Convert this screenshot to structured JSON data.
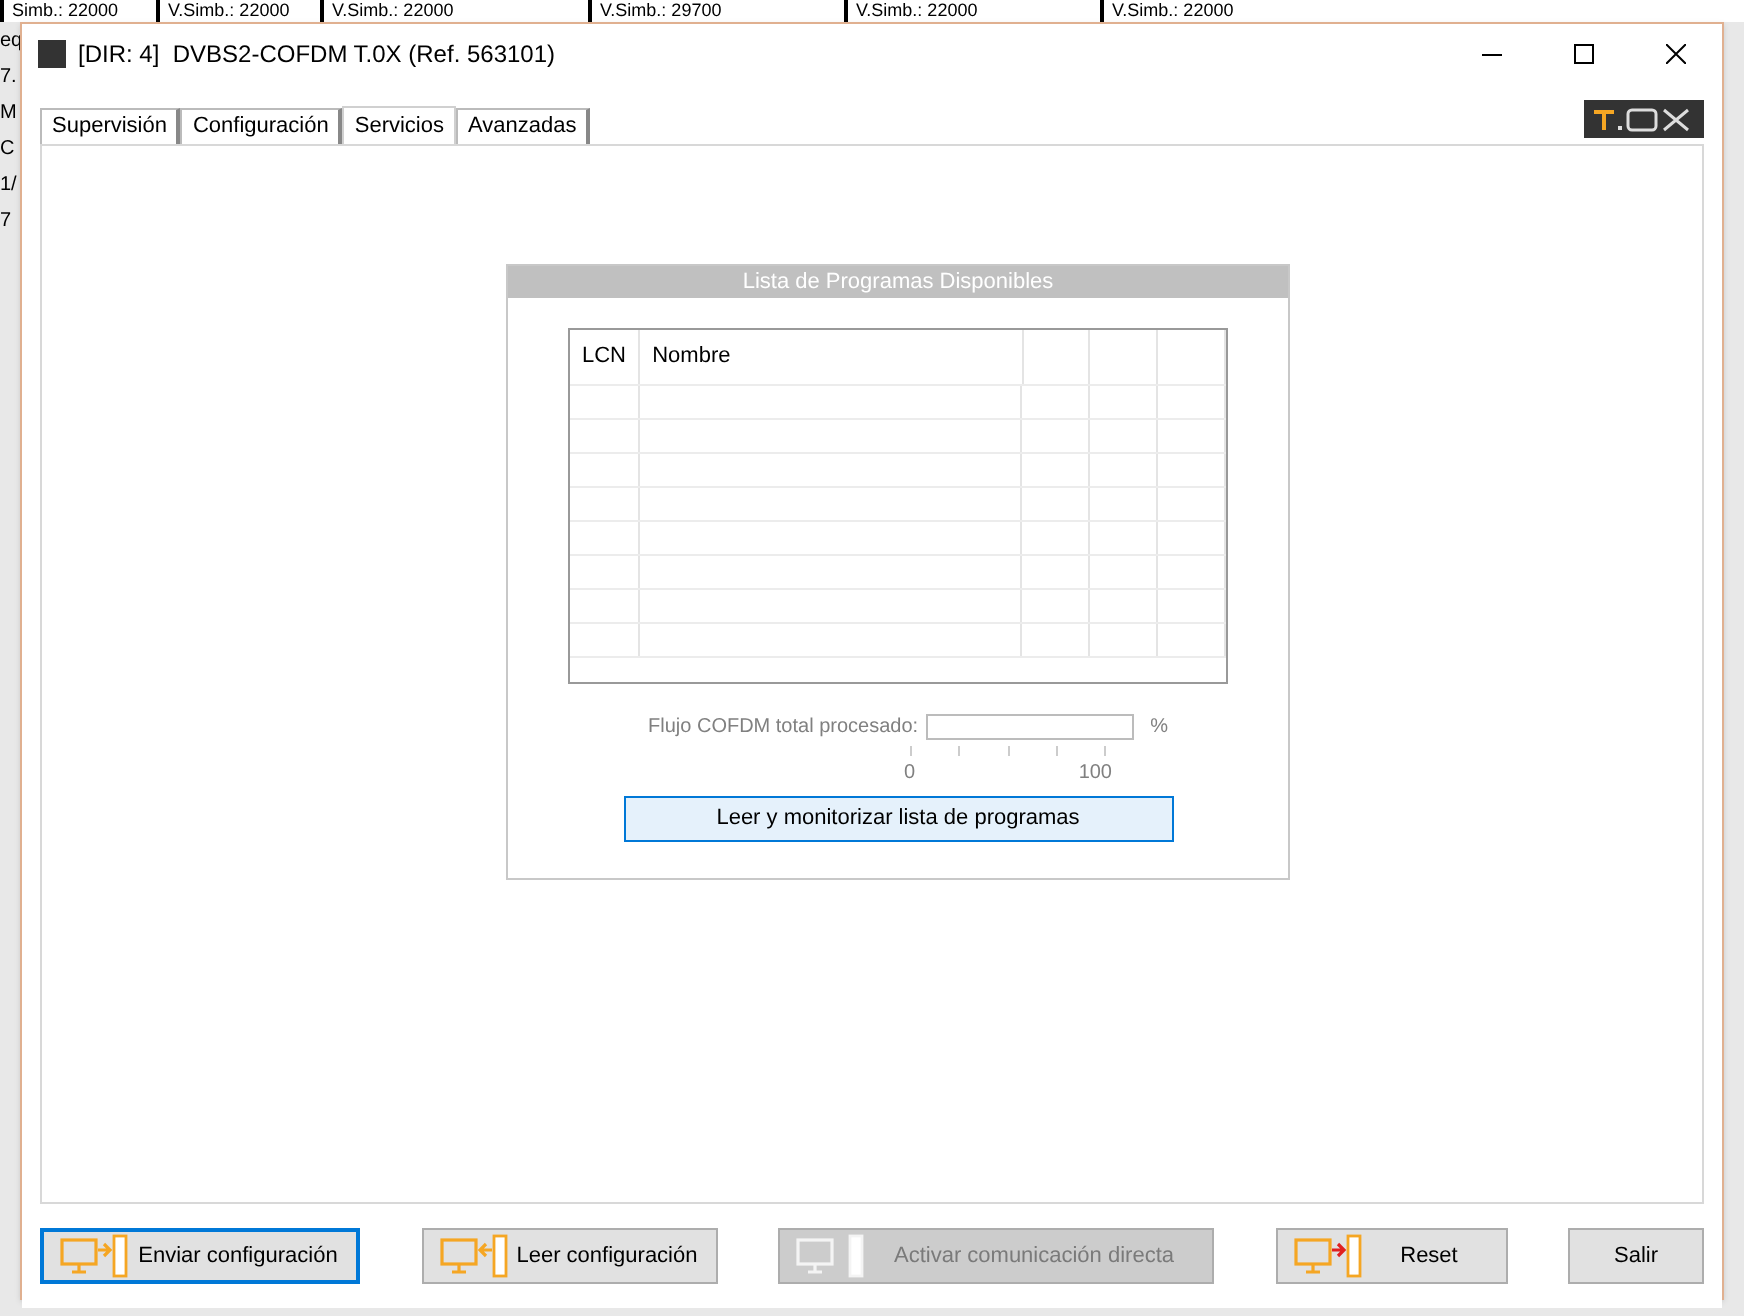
{
  "background_window": {
    "header_cells": [
      "Simb.: 22000",
      "V.Simb.: 22000",
      "V.Simb.: 22000",
      "V.Simb.: 29700",
      "V.Simb.: 22000",
      "V.Simb.: 22000"
    ],
    "side_fragments": [
      "eq",
      "7.",
      "M",
      "C",
      "1/",
      "7"
    ]
  },
  "window": {
    "title": "[DIR: 4]  DVBS2-COFDM T.0X (Ref. 563101)"
  },
  "tabs": [
    {
      "label": "Supervisión",
      "selected": false
    },
    {
      "label": "Configuración",
      "selected": false
    },
    {
      "label": "Servicios",
      "selected": true
    },
    {
      "label": "Avanzadas",
      "selected": false
    }
  ],
  "program_list": {
    "title": "Lista de Programas Disponibles",
    "columns": [
      "LCN",
      "Nombre"
    ]
  },
  "stream": {
    "label": "Flujo COFDM total procesado:",
    "level": 0,
    "unit": "%",
    "scale_min": "0",
    "scale_max": "100"
  },
  "read_button": {
    "label": "Leer y monitorizar lista de programas"
  },
  "buttons": [
    {
      "label": "Enviar configuración",
      "kind": "send",
      "disabled": false,
      "selected": true
    },
    {
      "label": "Leer configuración",
      "kind": "read",
      "disabled": false,
      "selected": false
    },
    {
      "label": "Activar comunicación directa",
      "kind": "direct",
      "disabled": true,
      "selected": false
    },
    {
      "label": "Reset",
      "kind": "reset",
      "disabled": false,
      "selected": false
    },
    {
      "label": "Salir",
      "kind": "plain",
      "disabled": false,
      "selected": false
    }
  ]
}
